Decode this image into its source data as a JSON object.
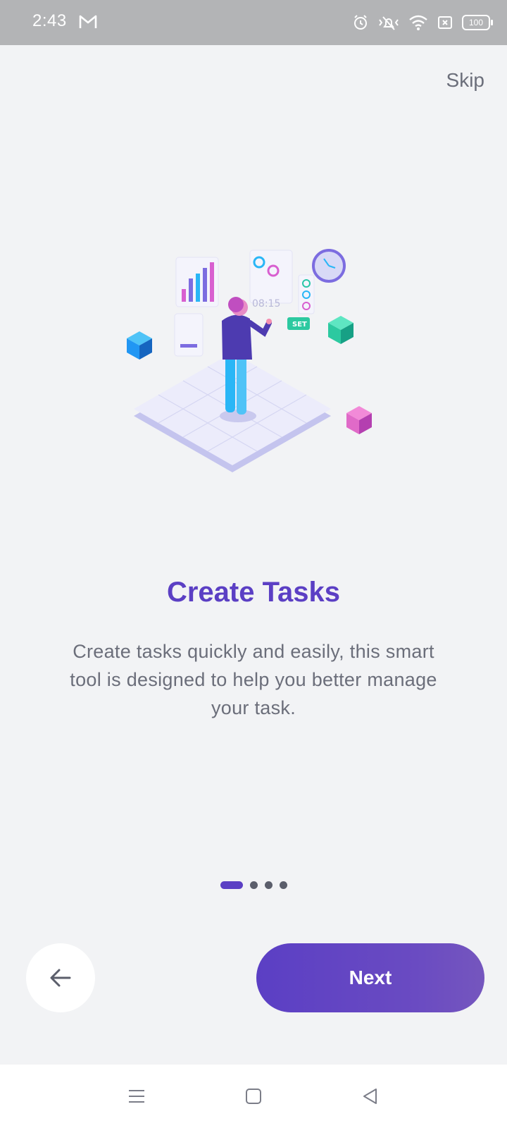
{
  "status_bar": {
    "time": "2:43",
    "battery": "100"
  },
  "header": {
    "skip_label": "Skip"
  },
  "onboarding": {
    "title": "Create Tasks",
    "description": "Create tasks quickly and easily, this smart tool is designed to help you better manage your task.",
    "illustration_texts": {
      "timer": "08:15",
      "set": "SET"
    },
    "page_count": 4,
    "current_page": 1
  },
  "buttons": {
    "next_label": "Next",
    "back_icon": "arrow-left-icon"
  },
  "colors": {
    "accent": "#5b3fc4",
    "background": "#f2f3f5",
    "status_bar": "#b3b4b6"
  },
  "nav_bar": {
    "icons": [
      "menu-icon",
      "home-square-icon",
      "back-triangle-icon"
    ]
  }
}
